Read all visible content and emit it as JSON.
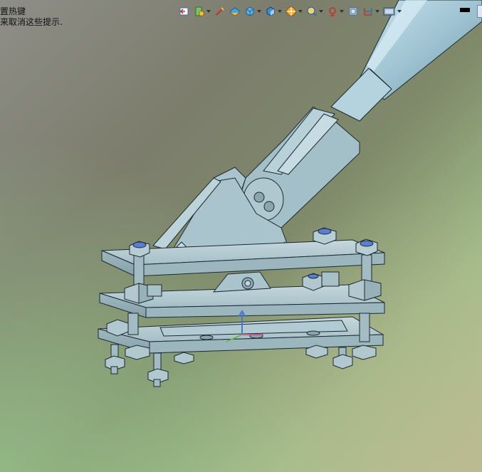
{
  "viewport": {
    "hint_line_1": "置热键",
    "hint_line_2": "来取消这些提示."
  },
  "toolbar": {
    "items": [
      {
        "icon": "previous-view-icon",
        "dropdown": false
      },
      {
        "icon": "dynamic-annotation-icon",
        "dropdown": true
      },
      {
        "icon": "section-view-icon",
        "dropdown": false
      },
      {
        "icon": "view-palette-icon",
        "dropdown": false
      },
      {
        "icon": "view-orientation-icon",
        "dropdown": true
      },
      {
        "icon": "display-style-icon",
        "dropdown": true
      },
      {
        "icon": "hide-show-items-icon",
        "dropdown": true
      },
      {
        "icon": "edit-appearance-icon",
        "dropdown": true
      },
      {
        "icon": "apply-scene-icon",
        "dropdown": true
      },
      {
        "icon": "view-settings-icon",
        "dropdown": false
      },
      {
        "icon": "rotate-view-icon",
        "dropdown": true
      },
      {
        "icon": "monitor-display-icon",
        "dropdown": true
      }
    ]
  },
  "colors": {
    "part_fill": "#a9c4cc",
    "part_edge": "#1c2a30",
    "tube_fill": "#9fc3d2"
  }
}
